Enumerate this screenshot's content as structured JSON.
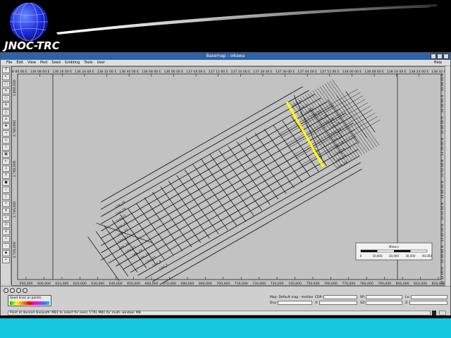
{
  "brand": {
    "name": "JNOC-TRC"
  },
  "window": {
    "title": "Basemap : oikawa"
  },
  "menu": {
    "items": [
      "File",
      "Edit",
      "View",
      "Post",
      "Seed",
      "Gridding",
      "Tools",
      "User"
    ],
    "help": "Help"
  },
  "map": {
    "top_ticks": [
      "138 00 00 E",
      "136 08 00 E",
      "136 16 00 E",
      "136 24 00 E",
      "136 32 00 E",
      "136 40 00 E",
      "136 48 00 E",
      "136 56 00 E",
      "137 04 00 E",
      "137 12 00 E",
      "137 20 00 E",
      "137 28 00 E",
      "137 36 00 E",
      "137 44 00 E",
      "137 52 00 E",
      "138 00 00 E",
      "138 08 00 E",
      "138 16 00 E",
      "138 24 00 E",
      "138 32 00 E"
    ],
    "bottom_ticks": [
      "590,000",
      "600,000",
      "610,000",
      "620,000",
      "630,000",
      "640,000",
      "650,000",
      "660,000",
      "670,000",
      "680,000",
      "690,000",
      "700,000",
      "710,000",
      "720,000",
      "730,000",
      "740,000",
      "750,000",
      "760,000",
      "770,000",
      "780,000",
      "790,000",
      "800,000",
      "810,000",
      "820,000"
    ],
    "left_ticks": [
      "3,800,000",
      "3,780,000",
      "3,760,000",
      "3,740,000",
      "3,720,000"
    ],
    "right_ticks": [
      "34 08 00 N",
      "34 04 00 N",
      "34 00 00 N",
      "33 56 00 N",
      "33 52 00 N",
      "33 48 00 N",
      "33 44 00 N",
      "33 40 00 N",
      "33 36 00 N",
      "33 32 00 N"
    ],
    "line_labels": [
      "Line_31",
      "Line_29",
      "Line_27",
      "Line_25",
      "Line_23",
      "Line_21",
      "Line_19",
      "Line_17",
      "Line_15",
      "Line_13",
      "Line_11",
      "Line_9",
      "Line_7",
      "Line_5",
      "Line_3",
      "Line_1",
      "Line_32",
      "Line_30",
      "Line_28",
      "Line_26",
      "Line_24",
      "Line_22",
      "Line_20",
      "Line_18",
      "Line_16",
      "Line_14"
    ],
    "scalebar": {
      "title": "Meters",
      "ticks": [
        "0",
        "10,000",
        "20,000",
        "30,000",
        "40,000"
      ]
    },
    "highlight_color": "#ffff00"
  },
  "panel": {
    "seed_label": "Seed lines or points",
    "fields": [
      {
        "label": "Map: Default map - meillon",
        "wide": true
      },
      {
        "label": "CDP:"
      },
      {
        "label": "SP:"
      },
      {
        "label": "Ln:"
      },
      {
        "label": "Dvy:"
      },
      {
        "label": "X:"
      },
      {
        "label": "SZ:"
      },
      {
        "label": "Z:"
      }
    ],
    "status": "Point at desired line/path: MB1 to select for seed, CTRL MB1 for multi- window: MB."
  }
}
